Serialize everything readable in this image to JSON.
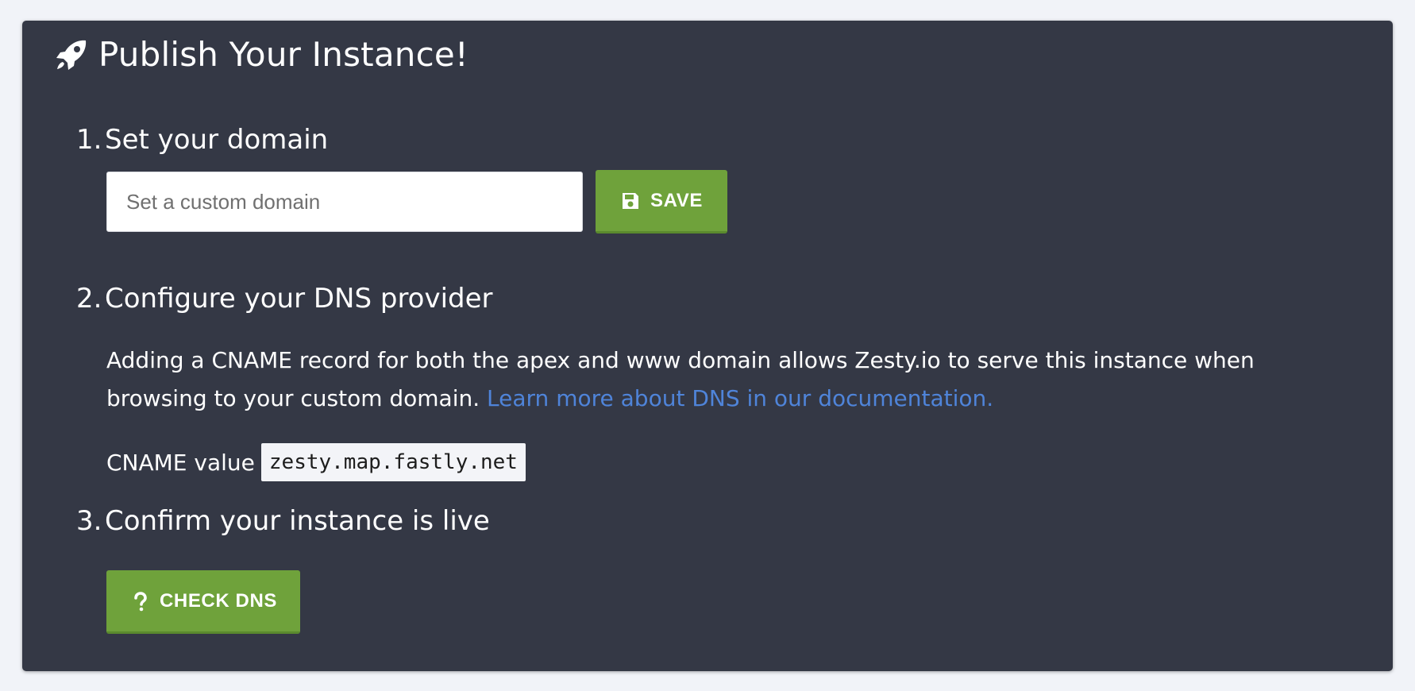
{
  "card": {
    "title": "Publish Your Instance!",
    "title_icon": "rocket-icon"
  },
  "step1": {
    "number": "1.",
    "title": "Set your domain",
    "input_placeholder": "Set a custom domain",
    "input_value": "",
    "save_label": "SAVE",
    "save_icon": "floppy-disk-icon"
  },
  "step2": {
    "number": "2.",
    "title": "Configure your DNS provider",
    "description": "Adding a CNAME record for both the apex and www domain allows Zesty.io to serve this instance when browsing to your custom domain.",
    "link_text": "Learn more about DNS in our documentation.",
    "cname_label": "CNAME value",
    "cname_value": "zesty.map.fastly.net"
  },
  "step3": {
    "number": "3.",
    "title": "Confirm your instance is live",
    "check_label": "CHECK DNS",
    "check_icon": "question-mark-icon"
  },
  "colors": {
    "page_background": "#f1f3f8",
    "card_background": "#343845",
    "button_green": "#6fa23b",
    "link_blue": "#4f84d9"
  }
}
